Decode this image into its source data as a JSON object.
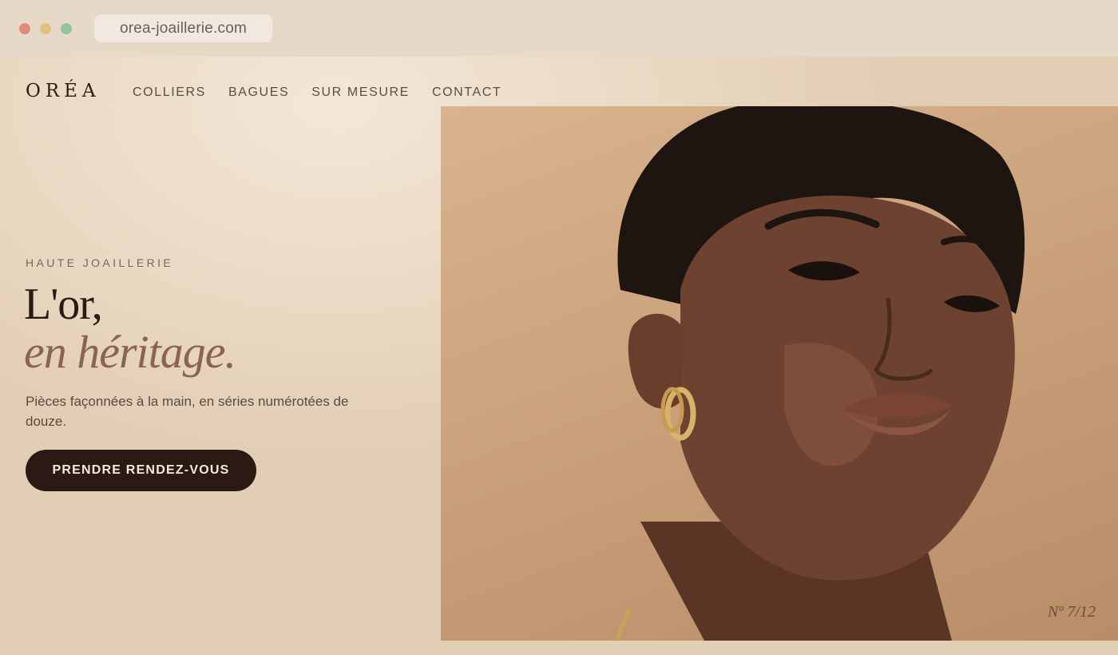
{
  "browser": {
    "url": "orea-joaillerie.com"
  },
  "header": {
    "logo": "ORÉA",
    "nav": [
      {
        "label": "COLLIERS"
      },
      {
        "label": "BAGUES"
      },
      {
        "label": "SUR MESURE"
      },
      {
        "label": "CONTACT"
      }
    ]
  },
  "hero": {
    "eyebrow": "HAUTE JOAILLERIE",
    "title_line1": "L'or,",
    "title_line2": "en héritage.",
    "lead": "Pièces façonnées à la main, en séries numérotées de douze.",
    "cta": "PRENDRE RENDEZ-VOUS",
    "counter": "Nº 7/12"
  },
  "colors": {
    "accent_dark": "#2b1a13",
    "accent_warm": "#8a6450",
    "background": "#ecdcc7"
  }
}
